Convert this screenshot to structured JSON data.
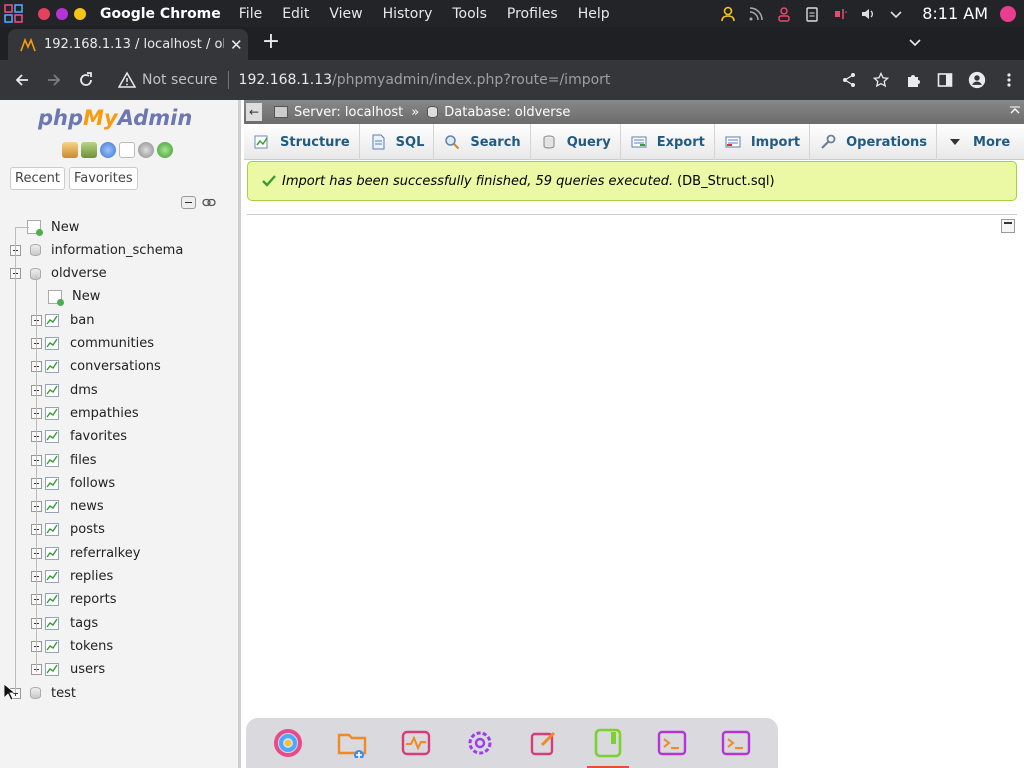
{
  "system_bar": {
    "app_name": "Google Chrome",
    "menu": [
      "File",
      "Edit",
      "View",
      "History",
      "Tools",
      "Profiles",
      "Help"
    ],
    "clock": "8:11 AM"
  },
  "browser": {
    "tab_title": "192.168.1.13 / localhost / oldverse",
    "security_label": "Not secure",
    "url_host": "192.168.1.13",
    "url_path": "/phpmyadmin/index.php?route=/import"
  },
  "sidebar": {
    "logo_php": "php",
    "logo_my": "My",
    "logo_admin": "Admin",
    "buttons": [
      "Recent",
      "Favorites"
    ],
    "tree": [
      {
        "label": "New",
        "kind": "new",
        "level": 0
      },
      {
        "label": "information_schema",
        "kind": "db",
        "level": 0,
        "expanded": false
      },
      {
        "label": "oldverse",
        "kind": "db",
        "level": 0,
        "expanded": true
      },
      {
        "label": "New",
        "kind": "new",
        "level": 1
      },
      {
        "label": "ban",
        "kind": "table",
        "level": 1
      },
      {
        "label": "communities",
        "kind": "table",
        "level": 1
      },
      {
        "label": "conversations",
        "kind": "table",
        "level": 1
      },
      {
        "label": "dms",
        "kind": "table",
        "level": 1
      },
      {
        "label": "empathies",
        "kind": "table",
        "level": 1
      },
      {
        "label": "favorites",
        "kind": "table",
        "level": 1
      },
      {
        "label": "files",
        "kind": "table",
        "level": 1
      },
      {
        "label": "follows",
        "kind": "table",
        "level": 1
      },
      {
        "label": "news",
        "kind": "table",
        "level": 1
      },
      {
        "label": "posts",
        "kind": "table",
        "level": 1
      },
      {
        "label": "referralkey",
        "kind": "table",
        "level": 1
      },
      {
        "label": "replies",
        "kind": "table",
        "level": 1
      },
      {
        "label": "reports",
        "kind": "table",
        "level": 1
      },
      {
        "label": "tags",
        "kind": "table",
        "level": 1
      },
      {
        "label": "tokens",
        "kind": "table",
        "level": 1
      },
      {
        "label": "users",
        "kind": "table",
        "level": 1
      },
      {
        "label": "test",
        "kind": "db",
        "level": 0,
        "expanded": false
      }
    ]
  },
  "breadcrumb": {
    "server": "Server: localhost",
    "separator": "»",
    "database": "Database: oldverse"
  },
  "tabs": [
    {
      "label": "Structure",
      "icon": "structure-icon"
    },
    {
      "label": "SQL",
      "icon": "sql-icon"
    },
    {
      "label": "Search",
      "icon": "search-icon"
    },
    {
      "label": "Query",
      "icon": "query-icon"
    },
    {
      "label": "Export",
      "icon": "export-icon"
    },
    {
      "label": "Import",
      "icon": "import-icon"
    },
    {
      "label": "Operations",
      "icon": "wrench-icon"
    },
    {
      "label": "More",
      "icon": "caret-down-icon"
    }
  ],
  "notice": {
    "message": "Import has been successfully finished, 59 queries executed.",
    "file": "(DB_Struct.sql)"
  },
  "dock": [
    "browser",
    "files",
    "system-monitor",
    "settings",
    "text-editor",
    "tablet",
    "terminal",
    "terminal-2"
  ],
  "colors": {
    "notice_bg": "#ebf8a4",
    "notice_border": "#a2d246",
    "tab_text": "#235a81",
    "logo_blue": "#6c78af",
    "logo_orange": "#f89c0e"
  }
}
